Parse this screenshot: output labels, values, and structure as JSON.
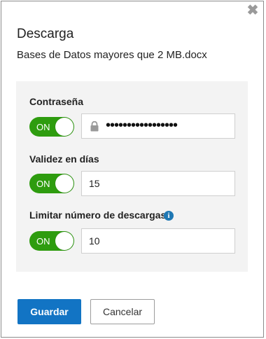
{
  "dialog": {
    "title": "Descarga",
    "filename": "Bases de Datos mayores que 2 MB.docx",
    "close_icon": "close-icon"
  },
  "fields": {
    "password": {
      "label": "Contraseña",
      "toggle": "ON",
      "value": "•••••••••••••••••",
      "icon": "lock-icon"
    },
    "validity": {
      "label": "Validez en días",
      "toggle": "ON",
      "value": "15"
    },
    "downloads": {
      "label": "Limitar número de descargas",
      "toggle": "ON",
      "value": "10",
      "info_icon": "i"
    }
  },
  "buttons": {
    "save": "Guardar",
    "cancel": "Cancelar"
  },
  "colors": {
    "toggle_on": "#2e9c0f",
    "primary": "#1274c4",
    "info": "#1f78b4"
  }
}
